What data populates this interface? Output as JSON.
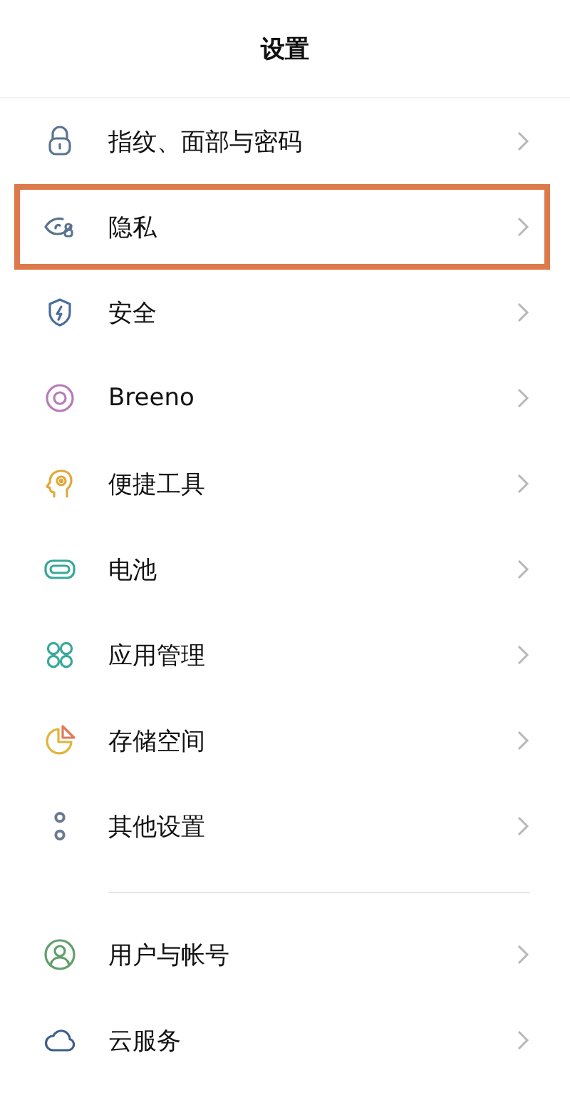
{
  "title": "设置",
  "sections": [
    {
      "items": [
        {
          "kind": "lock",
          "label": "指纹、面部与密码",
          "highlighted": false
        },
        {
          "kind": "privacy",
          "label": "隐私",
          "highlighted": true
        },
        {
          "kind": "shield",
          "label": "安全",
          "highlighted": false
        },
        {
          "kind": "ring",
          "label": "Breeno",
          "highlighted": false
        },
        {
          "kind": "head",
          "label": "便捷工具",
          "highlighted": false
        },
        {
          "kind": "battery",
          "label": "电池",
          "highlighted": false
        },
        {
          "kind": "apps",
          "label": "应用管理",
          "highlighted": false
        },
        {
          "kind": "pie",
          "label": "存储空间",
          "highlighted": false
        },
        {
          "kind": "dots",
          "label": "其他设置",
          "highlighted": false
        }
      ]
    },
    {
      "items": [
        {
          "kind": "user",
          "label": "用户与帐号",
          "highlighted": false
        },
        {
          "kind": "cloud",
          "label": "云服务",
          "highlighted": false
        }
      ]
    }
  ]
}
